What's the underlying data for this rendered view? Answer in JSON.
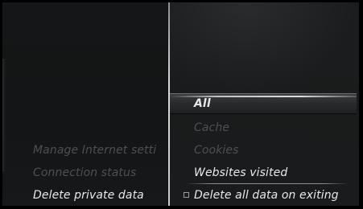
{
  "left_menu": {
    "items": [
      {
        "label": "Manage Internet setti",
        "state": "dim"
      },
      {
        "label": "Connection status",
        "state": "dim"
      },
      {
        "label": "Delete private data",
        "state": "active"
      }
    ]
  },
  "right_menu": {
    "items": [
      {
        "label": "All",
        "state": "selected"
      },
      {
        "label": "Cache",
        "state": "dim"
      },
      {
        "label": "Cookies",
        "state": "dim"
      },
      {
        "label": "Websites visited",
        "state": "active"
      },
      {
        "label": "Delete all data on exiting",
        "state": "active",
        "checkbox": false
      }
    ]
  },
  "colors": {
    "background": "#141516",
    "active_text": "#e8e8e8",
    "dim_text": "#4d4f52",
    "divider": "#d9dadb"
  },
  "icons": {
    "checkbox": "checkbox-unchecked-icon"
  }
}
